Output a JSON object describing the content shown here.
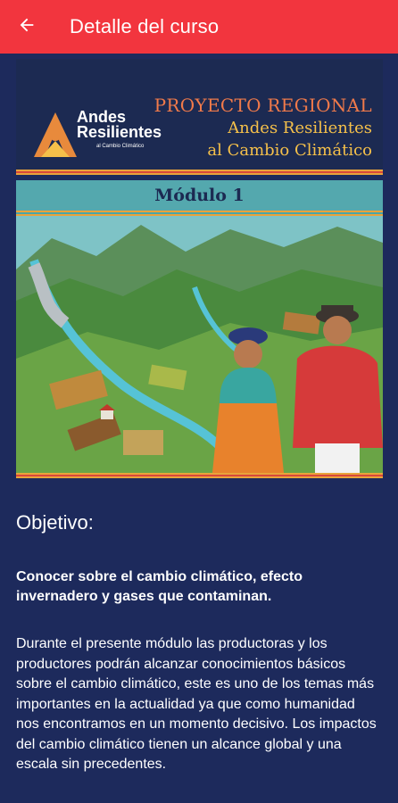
{
  "appbar": {
    "title": "Detalle del curso",
    "bg_color": "#f2353e",
    "back_icon": "arrow-left-icon"
  },
  "banner": {
    "logo_line1": "Andes",
    "logo_line2": "Resilientes",
    "logo_sub": "al Cambio Climático",
    "project_label": "PROYECTO REGIONAL",
    "project_name_line1": "Andes Resilientes",
    "project_name_line2": "al Cambio Climático",
    "module": "Módulo 1"
  },
  "content": {
    "heading": "Objetivo:",
    "lead": "Conocer sobre el cambio climático, efecto invernadero y gases que contaminan.",
    "body": "Durante el presente módulo las productoras y los productores podrán alcanzar conocimientos básicos sobre el cambio climático, este es uno de los temas más importantes en la actualidad ya que como humanidad nos encontramos en un momento decisivo. Los impactos del cambio climático tienen un alcance global y una escala sin precedentes."
  },
  "colors": {
    "background": "#1d2a5c",
    "accent": "#f2353e",
    "module_bar": "#54a8ae"
  }
}
